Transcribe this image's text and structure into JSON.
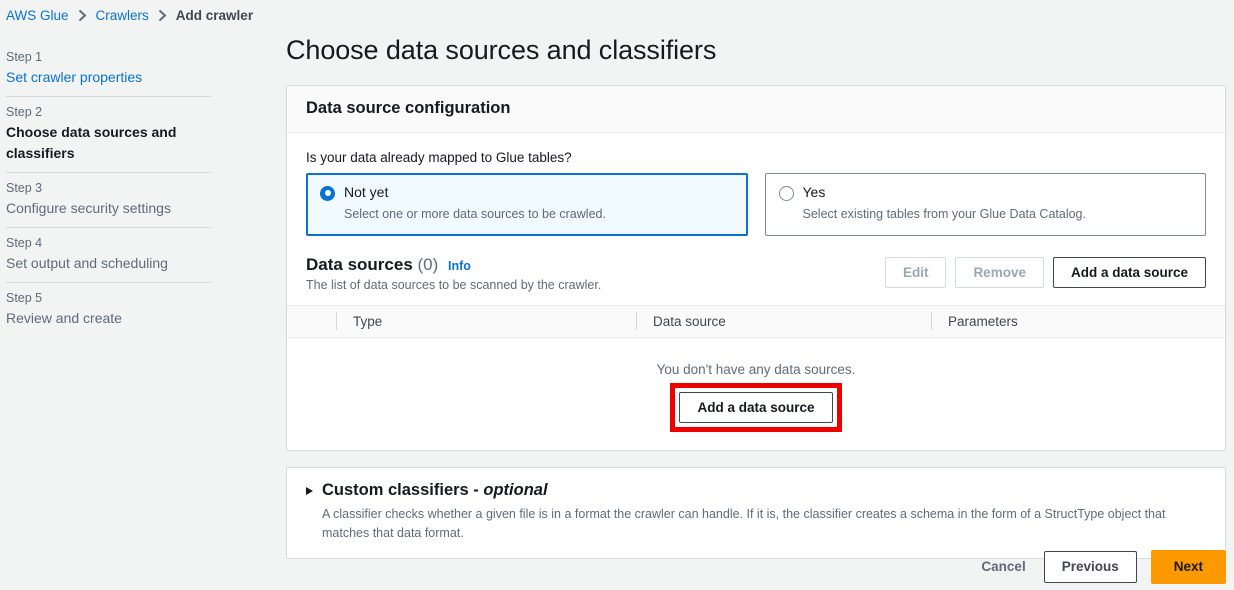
{
  "breadcrumb": {
    "items": [
      {
        "label": "AWS Glue",
        "current": false
      },
      {
        "label": "Crawlers",
        "current": false
      },
      {
        "label": "Add crawler",
        "current": true
      }
    ]
  },
  "sidebar": {
    "steps": [
      {
        "num": "Step 1",
        "name": "Set crawler properties",
        "state": "link"
      },
      {
        "num": "Step 2",
        "name": "Choose data sources and classifiers",
        "state": "active"
      },
      {
        "num": "Step 3",
        "name": "Configure security settings",
        "state": "pending"
      },
      {
        "num": "Step 4",
        "name": "Set output and scheduling",
        "state": "pending"
      },
      {
        "num": "Step 5",
        "name": "Review and create",
        "state": "pending"
      }
    ]
  },
  "page": {
    "title": "Choose data sources and classifiers"
  },
  "data_source_config": {
    "header": "Data source configuration",
    "question": "Is your data already mapped to Glue tables?",
    "options": [
      {
        "label": "Not yet",
        "description": "Select one or more data sources to be crawled.",
        "selected": true
      },
      {
        "label": "Yes",
        "description": "Select existing tables from your Glue Data Catalog.",
        "selected": false
      }
    ]
  },
  "data_sources": {
    "title": "Data sources",
    "count": "(0)",
    "info_link": "Info",
    "description": "The list of data sources to be scanned by the crawler.",
    "actions": [
      {
        "label": "Edit",
        "enabled": false
      },
      {
        "label": "Remove",
        "enabled": false
      },
      {
        "label": "Add a data source",
        "enabled": true
      }
    ],
    "table": {
      "columns": [
        "Type",
        "Data source",
        "Parameters"
      ],
      "rows": [],
      "empty_text": "You don't have any data sources.",
      "empty_button": "Add a data source"
    }
  },
  "custom_classifiers": {
    "title": "Custom classifiers - ",
    "title_optional": "optional",
    "expanded": false,
    "description": "A classifier checks whether a given file is in a format the crawler can handle. If it is, the classifier creates a schema in the form of a StructType object that matches that data format."
  },
  "footer": {
    "cancel": "Cancel",
    "previous": "Previous",
    "next": "Next"
  },
  "colors": {
    "accent_blue": "#0972d3",
    "aws_orange": "#ff9900",
    "highlight_red": "#ee0000",
    "page_background": "#f2f3f3"
  }
}
